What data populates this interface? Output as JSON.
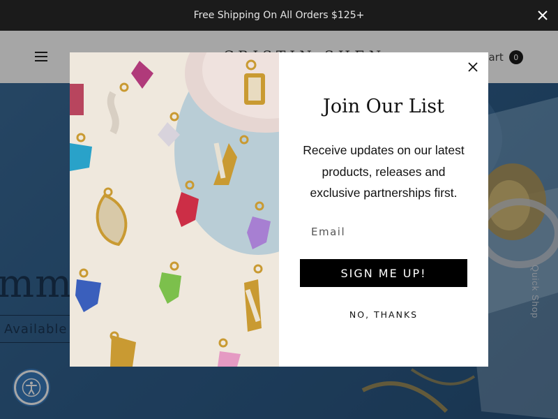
{
  "announcement": {
    "text": "Free Shipping On All Orders $125+"
  },
  "header": {
    "logo": "CRISTIN SHEN",
    "cart_label": "Cart",
    "cart_count": "0"
  },
  "hero": {
    "heading": "mm",
    "button_label": "Available",
    "quick_shop": "Quick Shop"
  },
  "modal": {
    "title": "Join Our List",
    "description": "Receive updates on our latest products, releases and exclusive partnerships first.",
    "email_placeholder": "Email",
    "submit_label": "SIGN ME UP!",
    "decline_label": "NO, THANKS"
  },
  "colors": {
    "brand_dark": "#000000",
    "accessibility": "#3a7bbd",
    "announcement_bg": "#1b1b1b"
  },
  "icons": [
    "close-icon",
    "hamburger-icon",
    "accessibility-icon",
    "cart-badge"
  ]
}
